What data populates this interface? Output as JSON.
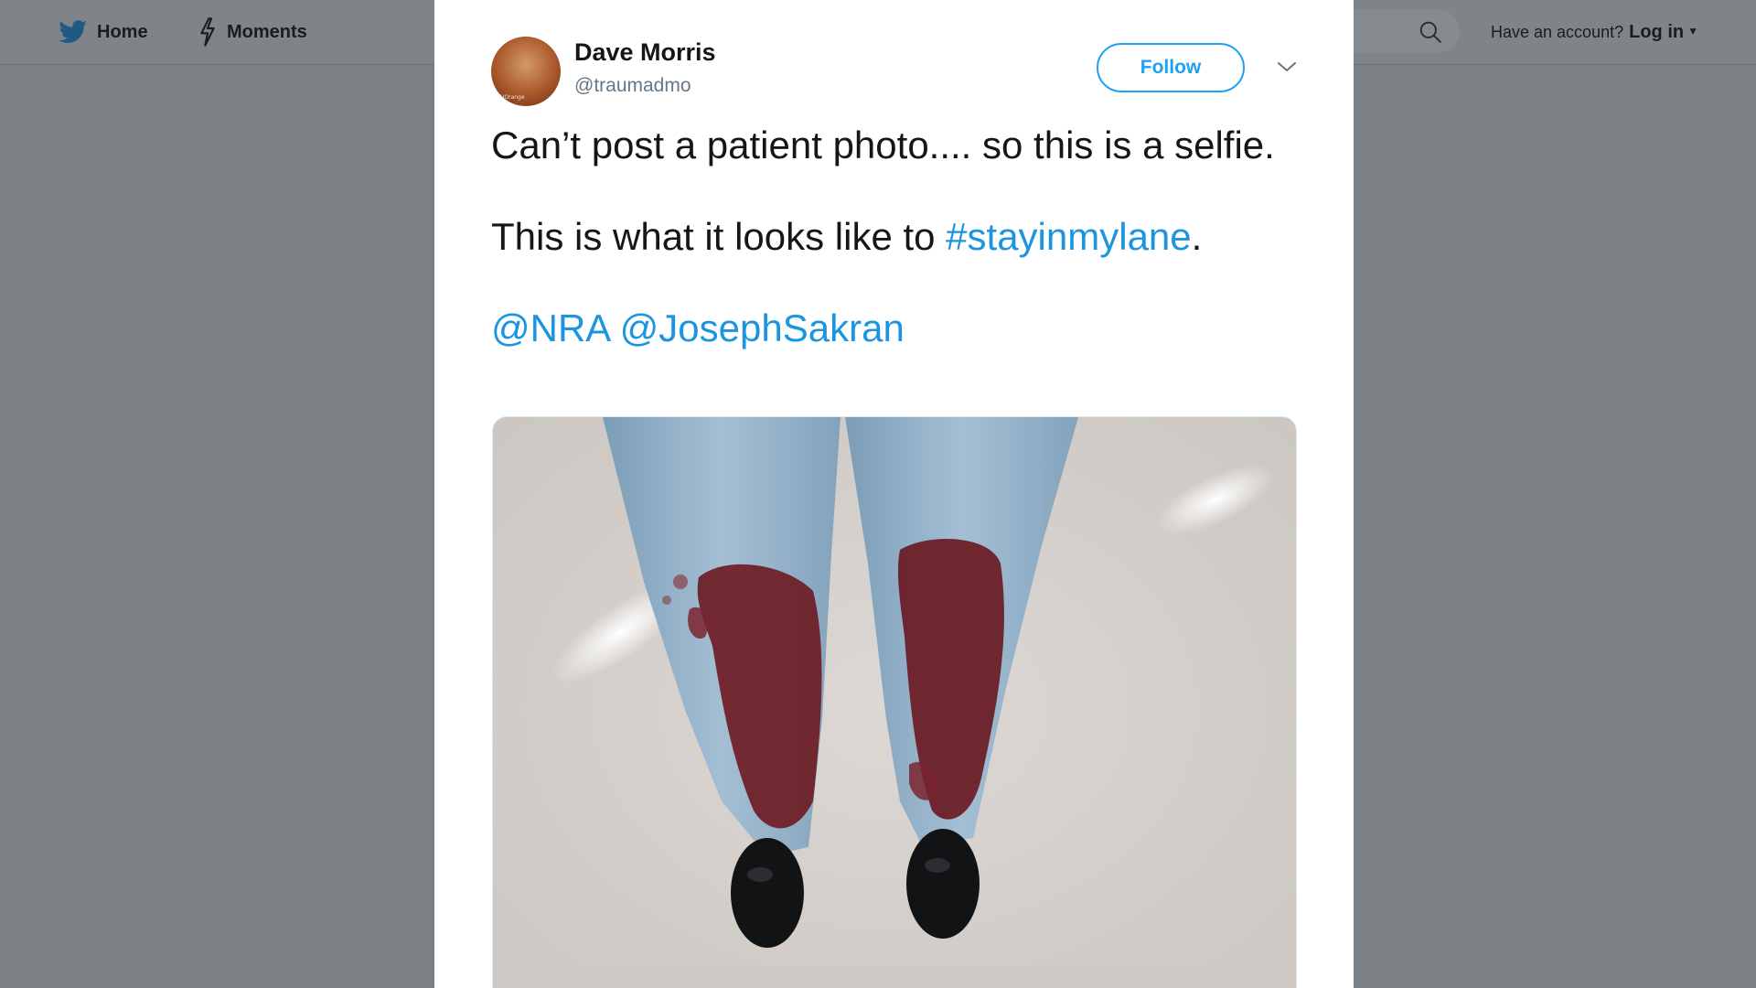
{
  "nav": {
    "home_label": "Home",
    "moments_label": "Moments",
    "account_question": "Have an account?",
    "login_label": "Log in"
  },
  "tweet": {
    "author": {
      "name": "Dave Morris",
      "handle": "@traumadmo",
      "avatar_badge": "UOrange"
    },
    "follow_label": "Follow",
    "text": {
      "line1": "Can’t post a patient photo.... so this is a selfie.",
      "line2_prefix": "This is what it looks like to ",
      "hashtag": "#stayinmylane",
      "line2_suffix": ".",
      "mention1": "@NRA",
      "mention2": "@JosephSakran"
    }
  },
  "colors": {
    "link": "#1b95e0",
    "follow_accent": "#1da1f2",
    "overlay": "#7b8185"
  },
  "icons": [
    "twitter-bird-icon",
    "lightning-icon",
    "search-icon",
    "chevron-down-icon",
    "caret-down-icon"
  ]
}
